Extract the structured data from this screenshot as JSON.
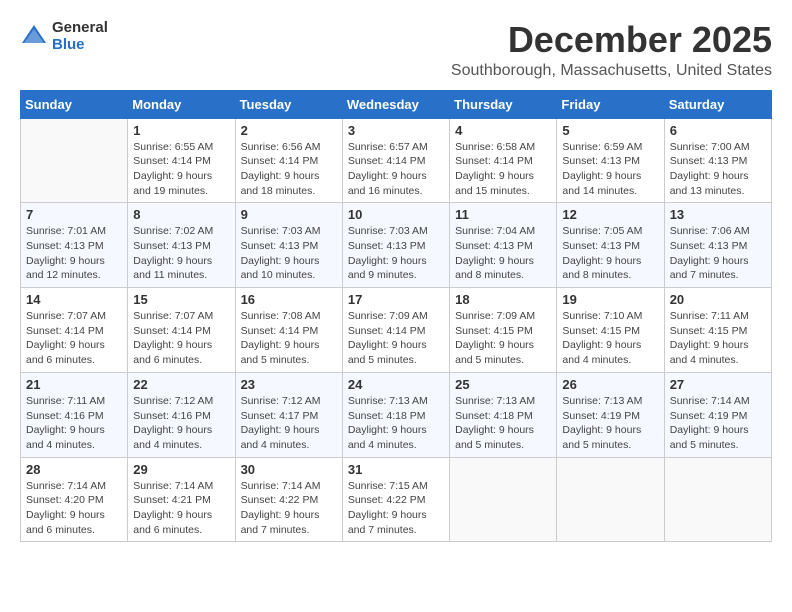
{
  "logo": {
    "general": "General",
    "blue": "Blue"
  },
  "title": "December 2025",
  "subtitle": "Southborough, Massachusetts, United States",
  "headers": [
    "Sunday",
    "Monday",
    "Tuesday",
    "Wednesday",
    "Thursday",
    "Friday",
    "Saturday"
  ],
  "weeks": [
    [
      {
        "day": "",
        "info": ""
      },
      {
        "day": "1",
        "info": "Sunrise: 6:55 AM\nSunset: 4:14 PM\nDaylight: 9 hours\nand 19 minutes."
      },
      {
        "day": "2",
        "info": "Sunrise: 6:56 AM\nSunset: 4:14 PM\nDaylight: 9 hours\nand 18 minutes."
      },
      {
        "day": "3",
        "info": "Sunrise: 6:57 AM\nSunset: 4:14 PM\nDaylight: 9 hours\nand 16 minutes."
      },
      {
        "day": "4",
        "info": "Sunrise: 6:58 AM\nSunset: 4:14 PM\nDaylight: 9 hours\nand 15 minutes."
      },
      {
        "day": "5",
        "info": "Sunrise: 6:59 AM\nSunset: 4:13 PM\nDaylight: 9 hours\nand 14 minutes."
      },
      {
        "day": "6",
        "info": "Sunrise: 7:00 AM\nSunset: 4:13 PM\nDaylight: 9 hours\nand 13 minutes."
      }
    ],
    [
      {
        "day": "7",
        "info": "Sunrise: 7:01 AM\nSunset: 4:13 PM\nDaylight: 9 hours\nand 12 minutes."
      },
      {
        "day": "8",
        "info": "Sunrise: 7:02 AM\nSunset: 4:13 PM\nDaylight: 9 hours\nand 11 minutes."
      },
      {
        "day": "9",
        "info": "Sunrise: 7:03 AM\nSunset: 4:13 PM\nDaylight: 9 hours\nand 10 minutes."
      },
      {
        "day": "10",
        "info": "Sunrise: 7:03 AM\nSunset: 4:13 PM\nDaylight: 9 hours\nand 9 minutes."
      },
      {
        "day": "11",
        "info": "Sunrise: 7:04 AM\nSunset: 4:13 PM\nDaylight: 9 hours\nand 8 minutes."
      },
      {
        "day": "12",
        "info": "Sunrise: 7:05 AM\nSunset: 4:13 PM\nDaylight: 9 hours\nand 8 minutes."
      },
      {
        "day": "13",
        "info": "Sunrise: 7:06 AM\nSunset: 4:13 PM\nDaylight: 9 hours\nand 7 minutes."
      }
    ],
    [
      {
        "day": "14",
        "info": "Sunrise: 7:07 AM\nSunset: 4:14 PM\nDaylight: 9 hours\nand 6 minutes."
      },
      {
        "day": "15",
        "info": "Sunrise: 7:07 AM\nSunset: 4:14 PM\nDaylight: 9 hours\nand 6 minutes."
      },
      {
        "day": "16",
        "info": "Sunrise: 7:08 AM\nSunset: 4:14 PM\nDaylight: 9 hours\nand 5 minutes."
      },
      {
        "day": "17",
        "info": "Sunrise: 7:09 AM\nSunset: 4:14 PM\nDaylight: 9 hours\nand 5 minutes."
      },
      {
        "day": "18",
        "info": "Sunrise: 7:09 AM\nSunset: 4:15 PM\nDaylight: 9 hours\nand 5 minutes."
      },
      {
        "day": "19",
        "info": "Sunrise: 7:10 AM\nSunset: 4:15 PM\nDaylight: 9 hours\nand 4 minutes."
      },
      {
        "day": "20",
        "info": "Sunrise: 7:11 AM\nSunset: 4:15 PM\nDaylight: 9 hours\nand 4 minutes."
      }
    ],
    [
      {
        "day": "21",
        "info": "Sunrise: 7:11 AM\nSunset: 4:16 PM\nDaylight: 9 hours\nand 4 minutes."
      },
      {
        "day": "22",
        "info": "Sunrise: 7:12 AM\nSunset: 4:16 PM\nDaylight: 9 hours\nand 4 minutes."
      },
      {
        "day": "23",
        "info": "Sunrise: 7:12 AM\nSunset: 4:17 PM\nDaylight: 9 hours\nand 4 minutes."
      },
      {
        "day": "24",
        "info": "Sunrise: 7:13 AM\nSunset: 4:18 PM\nDaylight: 9 hours\nand 4 minutes."
      },
      {
        "day": "25",
        "info": "Sunrise: 7:13 AM\nSunset: 4:18 PM\nDaylight: 9 hours\nand 5 minutes."
      },
      {
        "day": "26",
        "info": "Sunrise: 7:13 AM\nSunset: 4:19 PM\nDaylight: 9 hours\nand 5 minutes."
      },
      {
        "day": "27",
        "info": "Sunrise: 7:14 AM\nSunset: 4:19 PM\nDaylight: 9 hours\nand 5 minutes."
      }
    ],
    [
      {
        "day": "28",
        "info": "Sunrise: 7:14 AM\nSunset: 4:20 PM\nDaylight: 9 hours\nand 6 minutes."
      },
      {
        "day": "29",
        "info": "Sunrise: 7:14 AM\nSunset: 4:21 PM\nDaylight: 9 hours\nand 6 minutes."
      },
      {
        "day": "30",
        "info": "Sunrise: 7:14 AM\nSunset: 4:22 PM\nDaylight: 9 hours\nand 7 minutes."
      },
      {
        "day": "31",
        "info": "Sunrise: 7:15 AM\nSunset: 4:22 PM\nDaylight: 9 hours\nand 7 minutes."
      },
      {
        "day": "",
        "info": ""
      },
      {
        "day": "",
        "info": ""
      },
      {
        "day": "",
        "info": ""
      }
    ]
  ]
}
